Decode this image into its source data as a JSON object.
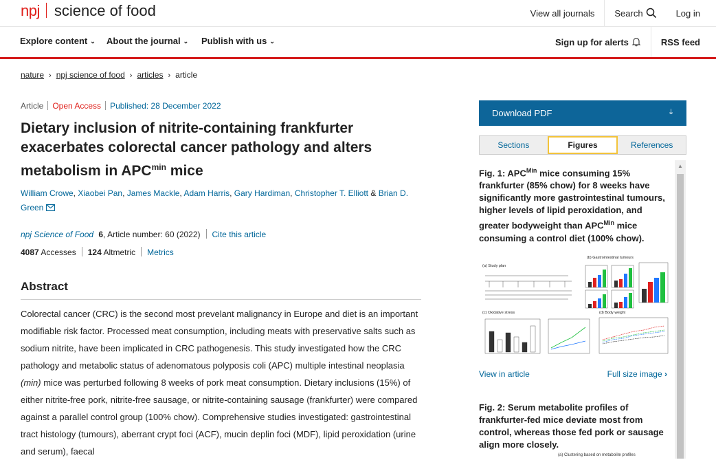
{
  "header": {
    "logo_npj": "npj",
    "logo_journal": "science of food",
    "links": [
      "View all journals",
      "Search",
      "Log in"
    ]
  },
  "nav": {
    "items": [
      "Explore content",
      "About the journal",
      "Publish with us"
    ],
    "alerts": "Sign up for alerts",
    "rss": "RSS feed"
  },
  "breadcrumb": [
    "nature",
    "npj science of food",
    "articles",
    "article"
  ],
  "article": {
    "type": "Article",
    "access": "Open Access",
    "published": "Published: 28 December 2022",
    "title_pre": "Dietary inclusion of nitrite-containing frankfurter exacerbates colorectal cancer pathology and alters metabolism in APC",
    "title_sup": "min",
    "title_post": " mice",
    "authors": [
      "William Crowe",
      "Xiaobei Pan",
      "James Mackle",
      "Adam Harris",
      "Gary Hardiman",
      "Christopher T. Elliott",
      "Brian D. Green"
    ],
    "author_joiner": "&",
    "journal": "npj Science of Food",
    "volume": "6",
    "article_number": ", Article number: 60 (2022)",
    "cite": "Cite this article",
    "accesses_num": "4087",
    "accesses_label": "Accesses",
    "altmetric_num": "124",
    "altmetric_label": "Altmetric",
    "metrics_link": "Metrics",
    "abstract_heading": "Abstract",
    "abstract_pre": "Colorectal cancer (CRC) is the second most prevelant malignancy in Europe and diet is an important modifiable risk factor. Processed meat consumption, including meats with preservative salts such as sodium nitrite, have been implicated in CRC pathogenesis. This study investigated how the CRC pathology and metabolic status of adenomatous polyposis coli (APC) multiple intestinal neoplasia ",
    "abstract_em": "(min)",
    "abstract_post": " mice was perturbed following 8 weeks of pork meat consumption. Dietary inclusions (15%) of either nitrite-free pork, nitrite-free sausage, or nitrite-containing sausage (frankfurter) were compared against a parallel control group (100% chow). Comprehensive studies investigated: gastrointestinal tract histology (tumours), aberrant crypt foci (ACF), mucin deplin foci (MDF), lipid peroxidation (urine and serum), faecal"
  },
  "sidebar": {
    "download": "Download PDF",
    "tabs": [
      "Sections",
      "Figures",
      "References"
    ],
    "active_tab": "Figures",
    "fig1": {
      "label": "Fig. 1:",
      "parts": [
        "APC",
        "Min",
        " mice consuming 15% frankfurter (85% chow) for 8 weeks have significantly more gastrointestinal tumours, higher levels of lipid peroxidation, and greater bodyweight than APC",
        "Min",
        " mice consuming a control diet (100% chow)."
      ],
      "panel_labels": [
        "(a) Study plan",
        "(b) Gastrointestinal tumours",
        "(c) Oxidative stress",
        "(d) Body weight"
      ],
      "view_link": "View in article",
      "full_link": "Full size image"
    },
    "fig2": {
      "label": "Fig. 2:",
      "text": "Serum metabolite profiles of frankfurter-fed mice deviate most from control, whereas those fed pork or sausage align more closely.",
      "panel_label": "(a) Clustering based on metabolite profiles"
    }
  },
  "colors": {
    "brand_red": "#e0201b",
    "pdf_blue": "#0d6599",
    "link": "#006699",
    "series": [
      "#333333",
      "#e02020",
      "#1f77ff",
      "#20c040"
    ]
  }
}
